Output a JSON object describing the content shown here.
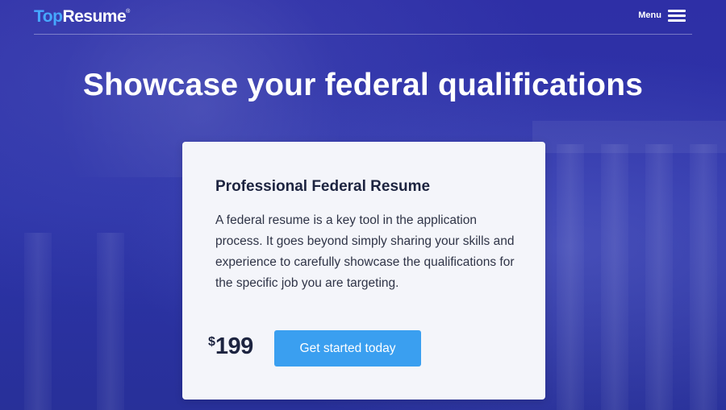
{
  "brand": {
    "logo_top": "Top",
    "logo_rest": "Resume",
    "logo_mark": "®",
    "accent_color": "#46a8ff"
  },
  "nav": {
    "menu_label": "Menu",
    "menu_icon": "hamburger-menu-icon"
  },
  "hero": {
    "headline": "Showcase your federal qualifications",
    "background_color": "#2e2fa6"
  },
  "card": {
    "title": "Professional Federal Resume",
    "description": "A federal resume is a key tool in the application process. It goes beyond simply sharing your skills and experience to carefully showcase the qualifications for the specific job you are targeting.",
    "price_currency": "$",
    "price_amount": "199",
    "cta_label": "Get started today",
    "cta_color": "#3a9ff0"
  }
}
